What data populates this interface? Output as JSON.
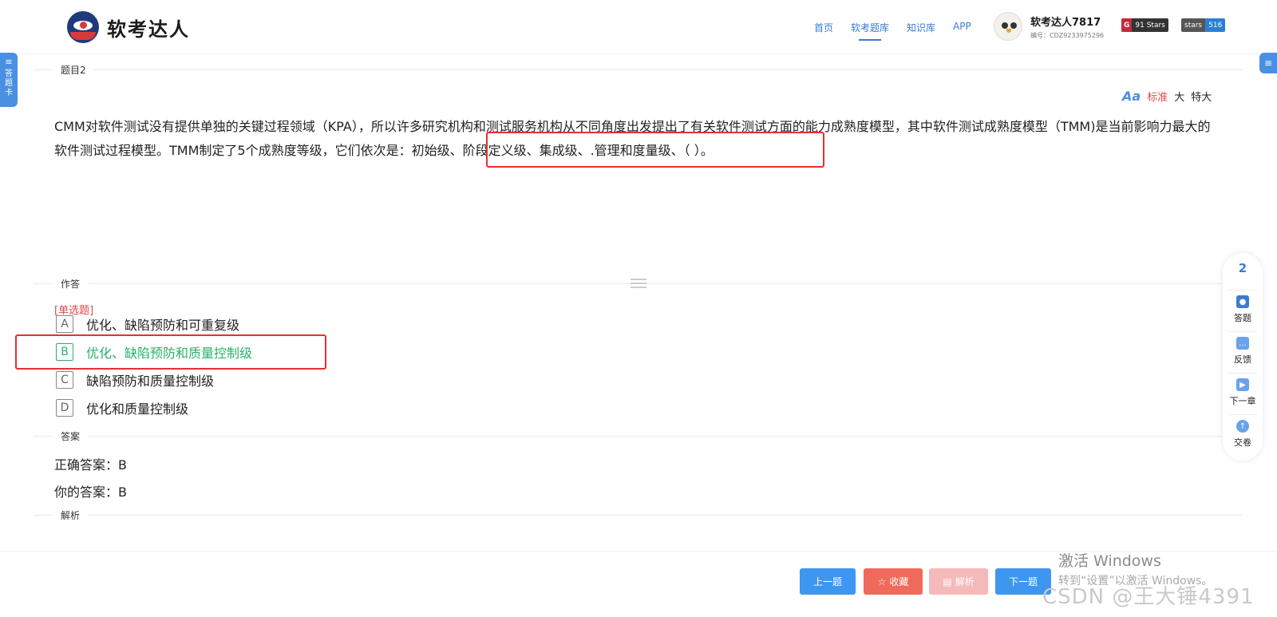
{
  "header": {
    "logo_text": "软考达人",
    "nav": [
      "首页",
      "软考题库",
      "知识库",
      "APP"
    ],
    "active_nav": "软考题库",
    "user_name": "软考达人7817",
    "user_id": "编号：CDZ9233975296",
    "badge_gitee": "91 Stars",
    "badge_github_label": "stars",
    "badge_github_count": "516"
  },
  "side_tab": {
    "label_1": "答",
    "label_2": "题",
    "label_3": "卡"
  },
  "question_section": {
    "label": "题目2",
    "font_sizes": [
      "标准",
      "大",
      "特大"
    ],
    "text_1": "CMM对软件测试没有提供单独的关键过程领域（KPA），所以许多研究机构和测试服务机构从不同角度出发提出了有关软件测试方面的能力成熟度模型，其中软件测试成熟度模型（TMM)是当前影",
    "text_2": "响力最大的软件测试过程模型。TMM制定了5个成熟度等级，它们依次是：",
    "text_3": "初始级、阶段定义级、集成级、.管理和度量级、（ ）。"
  },
  "answer_section": {
    "label": "作答",
    "type": "[单选题]",
    "options": [
      {
        "key": "A",
        "text": "优化、缺陷预防和可重复级"
      },
      {
        "key": "B",
        "text": "优化、缺陷预防和质量控制级"
      },
      {
        "key": "C",
        "text": "缺陷预防和质量控制级"
      },
      {
        "key": "D",
        "text": "优化和质量控制级"
      }
    ],
    "selected": "B"
  },
  "result_section": {
    "label": "答案",
    "correct": "正确答案：B",
    "yours": "你的答案：B"
  },
  "analysis_section": {
    "label": "解析"
  },
  "right_panel": {
    "number": "2",
    "items": [
      "答题",
      "反馈",
      "下一章",
      "交卷"
    ]
  },
  "footer": {
    "prev": "上一题",
    "fav": "收藏",
    "analysis": "解析",
    "next": "下一题"
  },
  "watermark": {
    "line1": "激活 Windows",
    "line2": "转到“设置”以激活 Windows。",
    "csdn": "CSDN @王大锤4391"
  },
  "colors": {
    "accent": "#3a7bd5",
    "correct": "#27b36b",
    "highlight": "#e53030"
  }
}
